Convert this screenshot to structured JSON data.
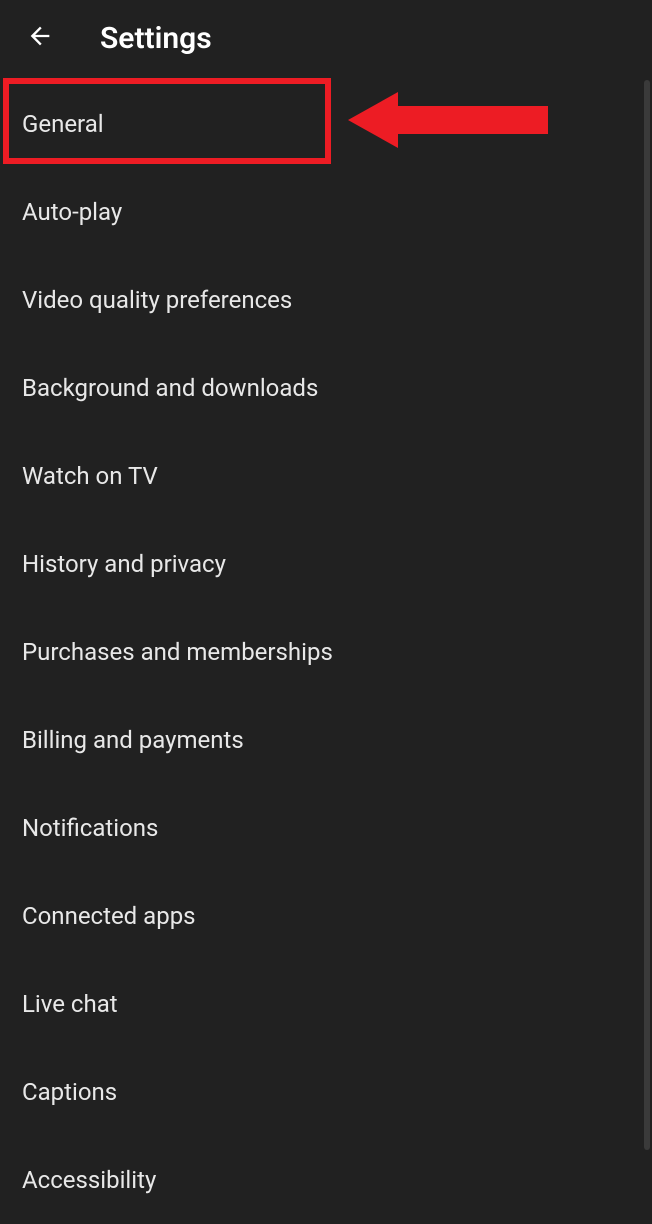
{
  "header": {
    "title": "Settings"
  },
  "items": [
    {
      "label": "General"
    },
    {
      "label": "Auto-play"
    },
    {
      "label": "Video quality preferences"
    },
    {
      "label": "Background and downloads"
    },
    {
      "label": "Watch on TV"
    },
    {
      "label": "History and privacy"
    },
    {
      "label": "Purchases and memberships"
    },
    {
      "label": "Billing and payments"
    },
    {
      "label": "Notifications"
    },
    {
      "label": "Connected apps"
    },
    {
      "label": "Live chat"
    },
    {
      "label": "Captions"
    },
    {
      "label": "Accessibility"
    }
  ]
}
